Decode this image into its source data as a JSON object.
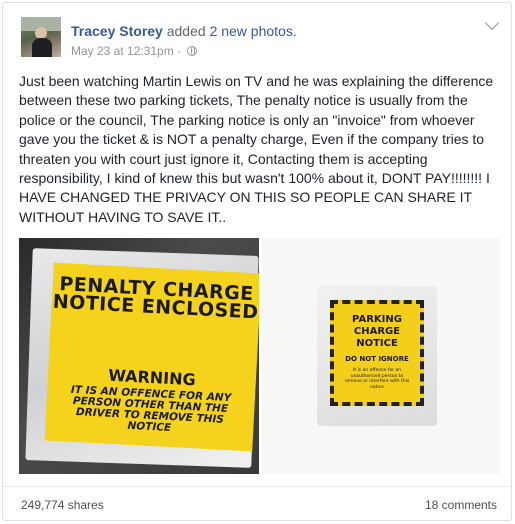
{
  "post": {
    "author": "Tracey Storey",
    "action_prefix": "added",
    "action_count": "2 new photos.",
    "timestamp": "May 23 at 12:31pm",
    "separator": "·",
    "text": "Just been watching Martin Lewis on TV and he was explaining the difference between these two parking tickets, The penalty notice is usually from the police or the council, The parking notice is only an \"invoice\" from whoever gave you the ticket & is NOT a penalty charge, Even if the company tries to threaten you with court just ignore it, Contacting them is accepting responsibility, I kind of knew this but wasn't 100% about it, DONT PAY!!!!!!!! I HAVE CHANGED THE PRIVACY ON THIS SO PEOPLE CAN SHARE IT WITHOUT HAVING TO SAVE IT..",
    "photo1": {
      "heading": "PENALTY CHARGE NOTICE ENCLOSED",
      "warning": "WARNING",
      "small": "IT IS AN OFFENCE FOR ANY PERSON OTHER THAN THE DRIVER TO REMOVE THIS NOTICE"
    },
    "photo2": {
      "heading": "PARKING CHARGE NOTICE",
      "sub": "DO NOT IGNORE",
      "small": "It is an offence for an unauthorised person to remove or interfere with this notice"
    }
  },
  "footer": {
    "shares": "249,774 shares",
    "comments": "18 comments"
  },
  "icons": {
    "privacy": "globe-icon",
    "menu": "chevron-down-icon"
  },
  "colors": {
    "link": "#365899",
    "meta": "#90949c",
    "ticket_yellow": "#f5d21b"
  }
}
